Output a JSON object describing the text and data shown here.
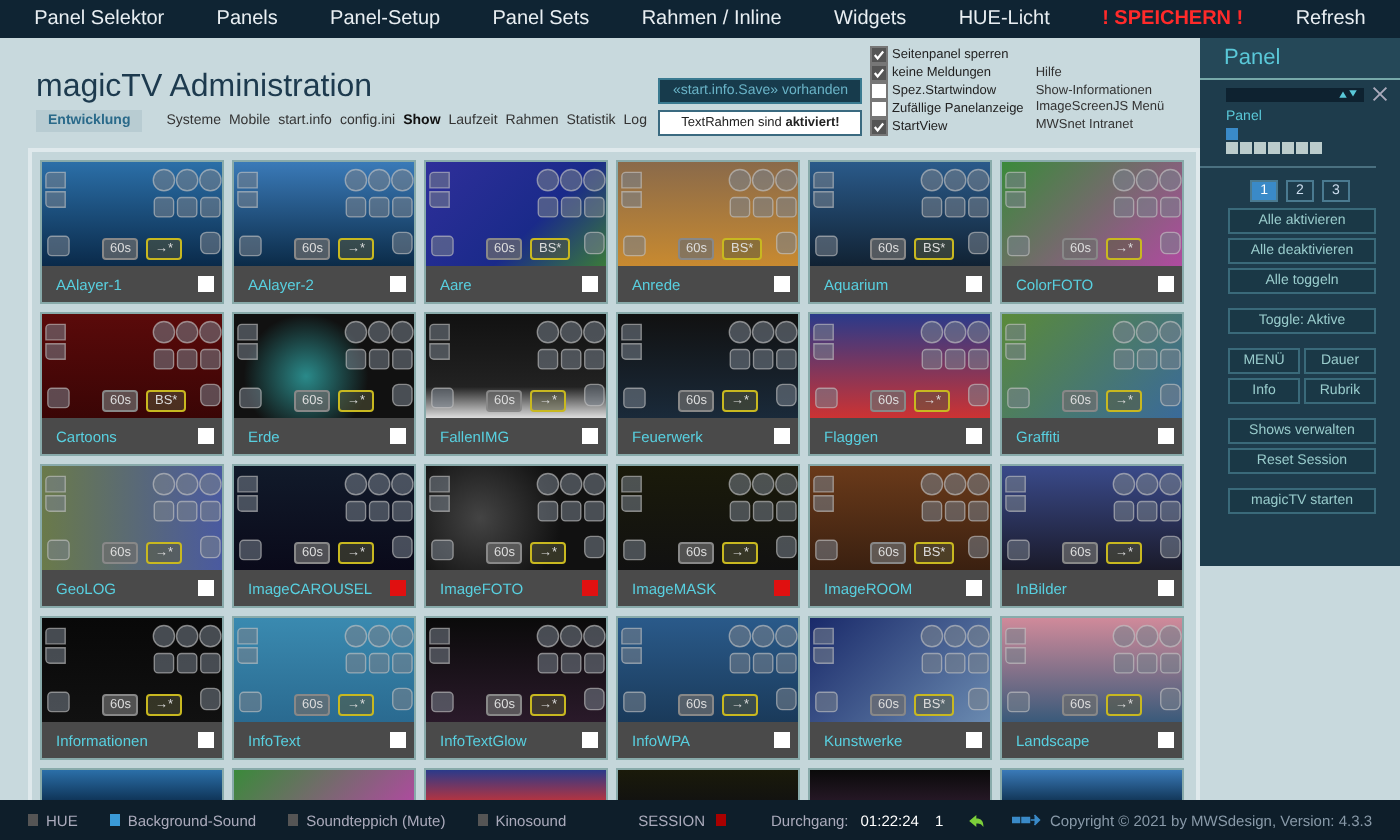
{
  "nav": [
    {
      "label": "Panel Selektor",
      "kind": "link"
    },
    {
      "label": "Panels",
      "kind": "link"
    },
    {
      "label": "Panel-Setup",
      "kind": "link"
    },
    {
      "label": "Panel Sets",
      "kind": "link"
    },
    {
      "label": "Rahmen / Inline",
      "kind": "link"
    },
    {
      "label": "Widgets",
      "kind": "link"
    },
    {
      "label": "HUE-Licht",
      "kind": "link"
    },
    {
      "label": "! SPEICHERN !",
      "kind": "alert"
    },
    {
      "label": "Refresh",
      "kind": "link"
    }
  ],
  "header": {
    "title": "magicTV Administration",
    "mode": "Entwicklung",
    "tabs": [
      {
        "label": "Systeme",
        "selected": false
      },
      {
        "label": "Mobile",
        "selected": false
      },
      {
        "label": "start.info",
        "selected": false
      },
      {
        "label": "config.ini",
        "selected": false
      },
      {
        "label": "Show",
        "selected": true
      },
      {
        "label": "Laufzeit",
        "selected": false
      },
      {
        "label": "Rahmen",
        "selected": false
      },
      {
        "label": "Statistik",
        "selected": false
      },
      {
        "label": "Log",
        "selected": false
      }
    ],
    "save_notice": "«start.info.Save» vorhanden",
    "frame_notice": "TextRahmen sind **aktiviert!**",
    "options": [
      {
        "label": "Seitenpanel sperren",
        "checked": true
      },
      {
        "label": "keine Meldungen",
        "checked": true
      },
      {
        "label": "Spez.Startwindow",
        "checked": false
      },
      {
        "label": "Zufällige Panelanzeige",
        "checked": false
      },
      {
        "label": "StartView",
        "checked": true
      }
    ],
    "links": [
      "Hilfe",
      "Show-Informationen",
      "ImageScreenJS Menü",
      "MWSnet Intranet"
    ]
  },
  "tiles": [
    {
      "kind": "full",
      "name": "AAlayer-1",
      "duration": "60s",
      "mode": "→*",
      "selected": false
    },
    {
      "kind": "full",
      "name": "AAlayer-2",
      "duration": "60s",
      "mode": "→*",
      "selected": false
    },
    {
      "kind": "full",
      "name": "Aare",
      "duration": "60s",
      "mode": "BS*",
      "selected": false
    },
    {
      "kind": "full",
      "name": "Anrede",
      "duration": "60s",
      "mode": "BS*",
      "selected": false
    },
    {
      "kind": "full",
      "name": "Aquarium",
      "duration": "60s",
      "mode": "BS*",
      "selected": false
    },
    {
      "kind": "full",
      "name": "ColorFOTO",
      "duration": "60s",
      "mode": "→*",
      "selected": false
    },
    {
      "kind": "full",
      "name": "Cartoons",
      "duration": "60s",
      "mode": "BS*",
      "selected": false
    },
    {
      "kind": "full",
      "name": "Erde",
      "duration": "60s",
      "mode": "→*",
      "selected": false
    },
    {
      "kind": "full",
      "name": "FallenIMG",
      "duration": "60s",
      "mode": "→*",
      "selected": false
    },
    {
      "kind": "full",
      "name": "Feuerwerk",
      "duration": "60s",
      "mode": "→*",
      "selected": false
    },
    {
      "kind": "full",
      "name": "Flaggen",
      "duration": "60s",
      "mode": "→*",
      "selected": false
    },
    {
      "kind": "full",
      "name": "Graffiti",
      "duration": "60s",
      "mode": "→*",
      "selected": false
    },
    {
      "kind": "full",
      "name": "GeoLOG",
      "duration": "60s",
      "mode": "→*",
      "selected": false
    },
    {
      "kind": "full",
      "name": "ImageCAROUSEL",
      "duration": "60s",
      "mode": "→*",
      "selected": true
    },
    {
      "kind": "full",
      "name": "ImageFOTO",
      "duration": "60s",
      "mode": "→*",
      "selected": true
    },
    {
      "kind": "full",
      "name": "ImageMASK",
      "duration": "60s",
      "mode": "→*",
      "selected": true
    },
    {
      "kind": "full",
      "name": "ImageROOM",
      "duration": "60s",
      "mode": "BS*",
      "selected": false
    },
    {
      "kind": "full",
      "name": "InBilder",
      "duration": "60s",
      "mode": "→*",
      "selected": false
    },
    {
      "kind": "full",
      "name": "Informationen",
      "duration": "60s",
      "mode": "→*",
      "selected": false
    },
    {
      "kind": "full",
      "name": "InfoText",
      "duration": "60s",
      "mode": "→*",
      "selected": false
    },
    {
      "kind": "full",
      "name": "InfoTextGlow",
      "duration": "60s",
      "mode": "→*",
      "selected": false
    },
    {
      "kind": "full",
      "name": "InfoWPA",
      "duration": "60s",
      "mode": "→*",
      "selected": false
    },
    {
      "kind": "full",
      "name": "Kunstwerke",
      "duration": "60s",
      "mode": "BS*",
      "selected": false
    },
    {
      "kind": "full",
      "name": "Landscape",
      "duration": "60s",
      "mode": "→*",
      "selected": false
    },
    {
      "kind": "cut"
    },
    {
      "kind": "cut"
    },
    {
      "kind": "cut"
    },
    {
      "kind": "cut"
    },
    {
      "kind": "cut"
    },
    {
      "kind": "cut"
    }
  ],
  "panel": {
    "title": "Panel",
    "label": "Panel",
    "slots": [
      {
        "selected": true
      },
      {
        "selected": false
      },
      {
        "selected": false
      },
      {
        "selected": false
      },
      {
        "selected": false
      },
      {
        "selected": false
      },
      {
        "selected": false
      }
    ],
    "pages": [
      {
        "label": "1",
        "selected": true
      },
      {
        "label": "2",
        "selected": false
      },
      {
        "label": "3",
        "selected": false
      }
    ],
    "groups": [
      [
        "Alle aktivieren",
        "Alle deaktivieren",
        "Alle toggeln"
      ],
      [
        "Toggle: Aktive"
      ],
      [
        "MENÜ",
        "Dauer",
        "Info",
        "Rubrik"
      ],
      [
        "Shows verwalten",
        "Reset Session"
      ],
      [
        "magicTV starten"
      ]
    ]
  },
  "status_bar": {
    "items": [
      {
        "label": "HUE",
        "on": false
      },
      {
        "label": "Background-Sound",
        "on": true
      },
      {
        "label": "Soundteppich (Mute)",
        "on": false
      },
      {
        "label": "Kinosound",
        "on": false
      }
    ],
    "session": {
      "label": "SESSION",
      "active": true
    },
    "run_label": "Durchgang:",
    "run_time": "01:22:24",
    "run_count": "1",
    "copyright": "Copyright © 2021 by MWSdesign, Version: 4.3.3"
  }
}
